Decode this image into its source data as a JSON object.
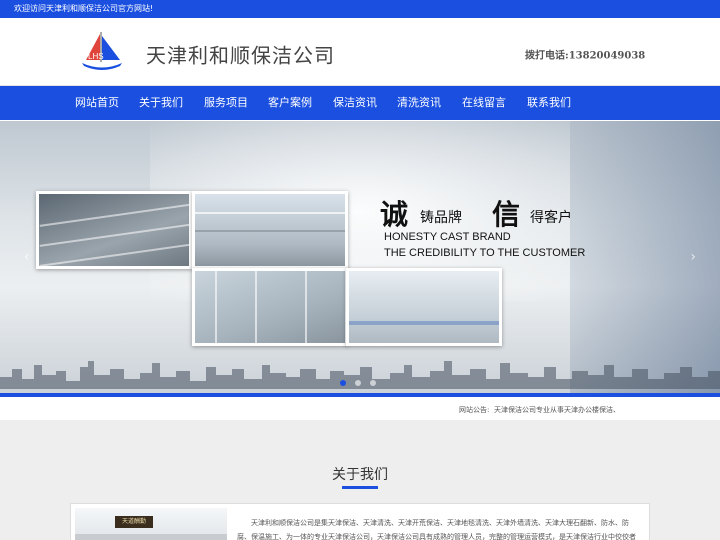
{
  "topbar": {
    "welcome": "欢迎访问天津利和顺保洁公司官方网站!"
  },
  "header": {
    "logo_text": "LHS",
    "company_name": "天津利和顺保洁公司",
    "hotline": "拨打电话:13820049038"
  },
  "nav": {
    "items": [
      {
        "label": "网站首页"
      },
      {
        "label": "关于我们"
      },
      {
        "label": "服务项目"
      },
      {
        "label": "客户案例"
      },
      {
        "label": "保洁资讯"
      },
      {
        "label": "清洗资讯"
      },
      {
        "label": "在线留言"
      },
      {
        "label": "联系我们"
      }
    ]
  },
  "banner": {
    "char1": "诚",
    "phrase1": "铸品牌",
    "char2": "信",
    "phrase2": "得客户",
    "english_line1": "HONESTY CAST BRAND",
    "english_line2": "THE CREDIBILITY TO THE CUSTOMER",
    "prev_arrow": "‹",
    "next_arrow": "›",
    "slides": 3,
    "active_slide": 1
  },
  "notice": {
    "label": "网站公告:",
    "text": "天津保洁公司专业从事天津办公楼保洁、"
  },
  "about": {
    "title": "关于我们",
    "intro": "天津利和顺保洁公司是集天津保洁、天津清洗、天津开荒保洁、天津地毯清洗、天津外墙清洗、天津大理石翻新、防水、防腐、保温施工、为一体的专业天津保洁公司，天津保洁公司具有成熟的管理人员，完整的管理运营模式，是天津保洁行业中佼佼者",
    "img_sign": "天道酬勤"
  },
  "colors": {
    "brand_blue": "#1a4fe0",
    "logo_red": "#e0443a",
    "logo_blue": "#1a4fe0"
  }
}
